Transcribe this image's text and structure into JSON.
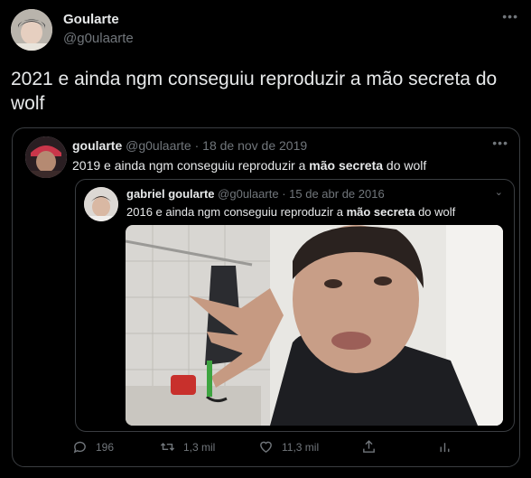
{
  "tweet": {
    "name": "Goularte",
    "handle": "@g0ulaarte",
    "text": "2021 e ainda ngm conseguiu reproduzir a mão secreta do wolf"
  },
  "quote1": {
    "name": "goularte",
    "handle": "@g0ulaarte",
    "sep": "·",
    "date": "18 de nov de 2019",
    "text_before": "2019 e ainda ngm conseguiu reproduzir a ",
    "text_bold": "mão secreta",
    "text_after": " do wolf"
  },
  "quote2": {
    "name": "gabriel goularte",
    "handle": "@g0ulaarte",
    "sep": "·",
    "date": "15 de abr de 2016",
    "text_before": "2016 e ainda ngm conseguiu reproduzir a ",
    "text_bold": "mão secreta",
    "text_after": " do wolf"
  },
  "actions": {
    "replies": "196",
    "retweets": "1,3 mil",
    "likes": "11,3 mil"
  },
  "colors": {
    "background": "#000000",
    "text": "#e7e9ea",
    "muted": "#71767b",
    "border": "#3a3d41"
  },
  "icons": [
    "more-icon",
    "chevron-down-icon",
    "reply-icon",
    "retweet-icon",
    "like-icon",
    "share-icon",
    "analytics-icon"
  ]
}
